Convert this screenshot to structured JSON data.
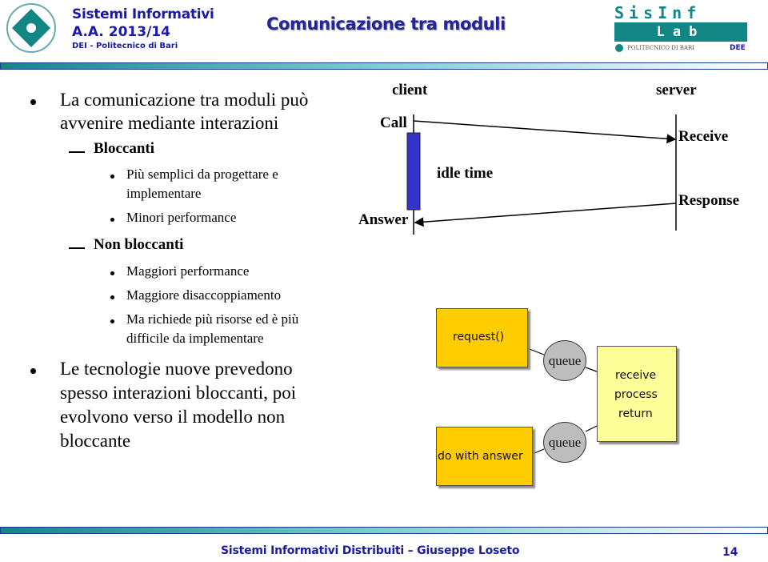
{
  "header": {
    "course_title": "Sistemi Informativi",
    "academic_year": "A.A. 2013/14",
    "department": "DEI - Politecnico di Bari",
    "slide_title": "Comunicazione tra moduli",
    "lab_logo_top": "SisInf",
    "lab_logo_bottom": "Lab",
    "lab_logo_caption": "POLITECNICO DI BARI",
    "lab_logo_dee": "DEE"
  },
  "content": {
    "bullet1": {
      "line1": "La comunicazione tra moduli può",
      "line2": "avvenire mediante interazioni"
    },
    "blocking": {
      "label": "Bloccanti",
      "items": [
        {
          "line1": "Più semplici da progettare e",
          "line2": "implementare"
        },
        {
          "line1": "Minori performance"
        }
      ]
    },
    "non_blocking": {
      "label": "Non bloccanti",
      "items": [
        {
          "line1": "Maggiori performance"
        },
        {
          "line1": "Maggiore disaccoppiamento"
        },
        {
          "line1": "Ma richiede più risorse ed è più",
          "line2": "difficile da implementare"
        }
      ]
    },
    "bullet2": {
      "line1": "Le tecnologie nuove prevedono",
      "line2": "spesso interazioni bloccanti, poi",
      "line3": "evolvono verso il modello non",
      "line4": "bloccante"
    }
  },
  "sync_diagram": {
    "client_label": "client",
    "server_label": "server",
    "call_label": "Call",
    "answer_label": "Answer",
    "receive_label": "Receive",
    "response_label": "Response",
    "idle_label": "idle time",
    "idle_color": "#3333cc"
  },
  "async_diagram": {
    "request_label": "request()",
    "do_with_answer_label": "do with answer",
    "queue1_label": "queue",
    "queue2_label": "queue",
    "server_steps": [
      "receive",
      "process",
      "return"
    ],
    "client_box_color": "#ffcc00",
    "server_box_color": "#ffff99",
    "queue_color": "#bdbdbd"
  },
  "footer": {
    "text": "Sistemi Informativi Distribuiti – Giuseppe Loseto",
    "page_number": "14"
  }
}
